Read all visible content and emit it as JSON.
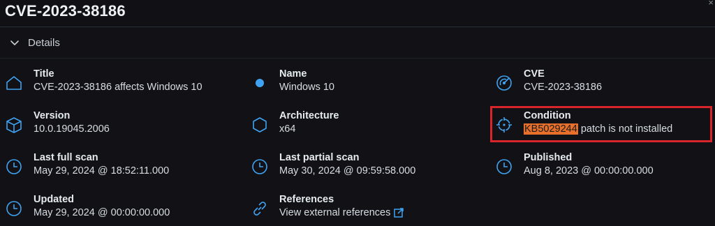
{
  "header": {
    "title": "CVE-2023-38186",
    "close_glyph": "×"
  },
  "section": {
    "label": "Details",
    "icon": "chevron-down-icon"
  },
  "fields": {
    "title": {
      "label": "Title",
      "value": "CVE-2023-38186 affects Windows 10",
      "icon": "home-icon"
    },
    "name": {
      "label": "Name",
      "value": "Windows 10",
      "icon": "dot-icon"
    },
    "cve": {
      "label": "CVE",
      "value": "CVE-2023-38186",
      "icon": "radar-icon"
    },
    "version": {
      "label": "Version",
      "value": "10.0.19045.2006",
      "icon": "package-icon"
    },
    "architecture": {
      "label": "Architecture",
      "value": "x64",
      "icon": "hexagon-icon"
    },
    "condition": {
      "label": "Condition",
      "value_highlight": "KB5029244",
      "value_rest": " patch is not installed",
      "icon": "crosshair-icon"
    },
    "last_full_scan": {
      "label": "Last full scan",
      "value": "May 29, 2024 @ 18:52:11.000",
      "icon": "clock-icon"
    },
    "last_partial_scan": {
      "label": "Last partial scan",
      "value": "May 30, 2024 @ 09:59:58.000",
      "icon": "clock-icon"
    },
    "published": {
      "label": "Published",
      "value": "Aug 8, 2023 @ 00:00:00.000",
      "icon": "clock-icon"
    },
    "updated": {
      "label": "Updated",
      "value": "May 29, 2024 @ 00:00:00.000",
      "icon": "clock-icon"
    },
    "references": {
      "label": "References",
      "value": "View external references",
      "icon": "link-icon"
    }
  },
  "colors": {
    "icon": "#3fa3f2",
    "highlight": "#e8702a",
    "annotation": "#d8252b",
    "background": "#111116"
  }
}
